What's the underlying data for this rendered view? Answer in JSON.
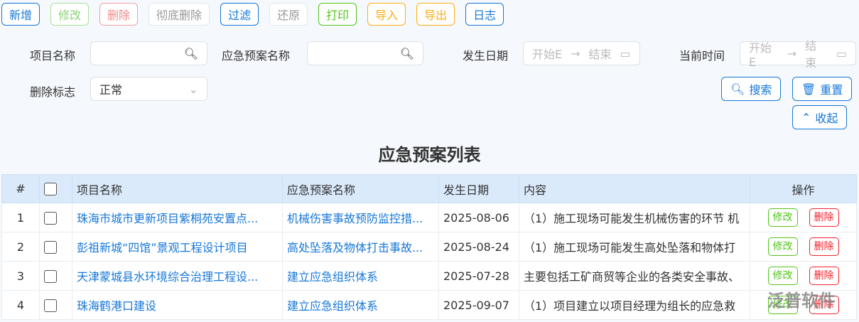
{
  "toolbar": [
    {
      "label": "新增",
      "style": "b-blue"
    },
    {
      "label": "修改",
      "style": "b-lgreen"
    },
    {
      "label": "删除",
      "style": "b-lred"
    },
    {
      "label": "彻底删除",
      "style": "b-gray"
    },
    {
      "label": "过滤",
      "style": "b-blue"
    },
    {
      "label": "还原",
      "style": "b-gray"
    },
    {
      "label": "打印",
      "style": "b-green"
    },
    {
      "label": "导入",
      "style": "b-orange"
    },
    {
      "label": "导出",
      "style": "b-orange"
    },
    {
      "label": "日志",
      "style": "b-blue"
    }
  ],
  "filters": {
    "project_label": "项目名称",
    "project_value": "",
    "plan_label": "应急预案名称",
    "plan_value": "",
    "date_label": "发生日期",
    "date_start": "开始E",
    "date_end": "结束",
    "time_label": "当前时间",
    "time_start": "开始E",
    "time_end": "结束",
    "delete_label": "删除标志",
    "delete_value": "正常",
    "search": "搜索",
    "reset": "重置",
    "collapse": "收起"
  },
  "table": {
    "title": "应急预案列表",
    "headers": [
      "#",
      "",
      "项目名称",
      "应急预案名称",
      "发生日期",
      "内容",
      "操作"
    ],
    "edit": "修改",
    "del": "删除",
    "rows": [
      [
        "1",
        "珠海市城市更新项目紫桐苑安置点...",
        "机械伤害事故预防监控措...",
        "2025-08-06",
        "（1）施工现场可能发生机械伤害的环节 机"
      ],
      [
        "2",
        "彭祖新城“四馆”景观工程设计项目",
        "高处坠落及物体打击事故...",
        "2025-08-24",
        "（1）施工现场可能发生高处坠落和物体打"
      ],
      [
        "3",
        "天津蒙城县水环境综合治理工程设...",
        "建立应急组织体系",
        "2025-07-28",
        "主要包括工矿商贸等企业的各类安全事故、"
      ],
      [
        "4",
        "珠海鹤港口建设",
        "建立应急组织体系",
        "2025-09-07",
        "（1）项目建立以项目经理为组长的应急救"
      ]
    ]
  },
  "watermark": "泛普软件",
  "colors": {
    "primary": "#1677d9",
    "success": "#52c41a",
    "danger": "#f5222d",
    "warning": "#faad14"
  }
}
